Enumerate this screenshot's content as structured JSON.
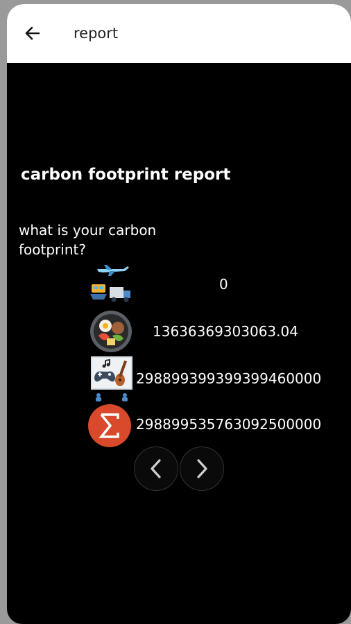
{
  "appbar": {
    "title": "report"
  },
  "report": {
    "heading": "carbon footprint report",
    "question": "what is your carbon footprint?"
  },
  "rows": [
    {
      "icon": "transport-icon",
      "value": "0"
    },
    {
      "icon": "food-icon",
      "value": "13636369303063.04"
    },
    {
      "icon": "leisure-icon",
      "value": "298899399399399460000"
    },
    {
      "icon": "sum-icon",
      "value": "298899535763092500000"
    }
  ],
  "colors": {
    "background": "#000000",
    "appbar": "#ffffff",
    "sum_badge": "#d84a2b"
  }
}
